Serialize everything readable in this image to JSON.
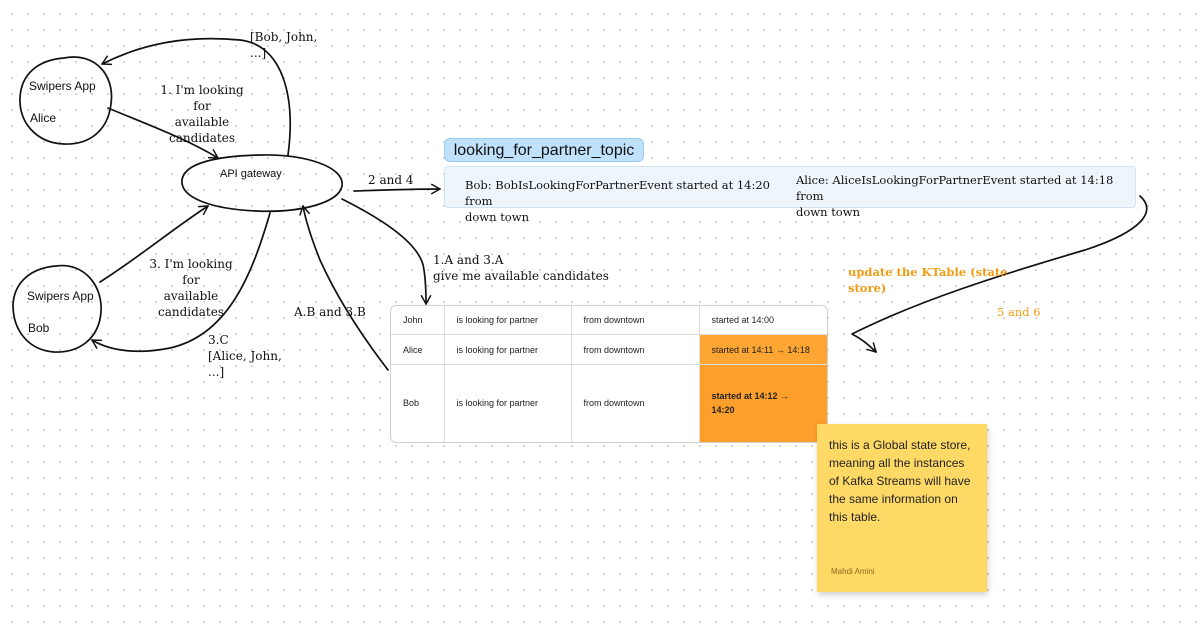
{
  "nodes": {
    "alice_app": {
      "title": "Swipers App",
      "user": "Alice"
    },
    "bob_app": {
      "title": "Swipers App",
      "user": "Bob"
    },
    "gateway": {
      "label": "API gateway"
    }
  },
  "annotations": {
    "alice_request": [
      "1. I'm looking for",
      "available",
      "candidates"
    ],
    "bob_request": [
      "3. I'm looking for",
      "available",
      "candidates"
    ],
    "alice_response": [
      "[Bob, John,",
      "...]"
    ],
    "bob_response": [
      "3.C",
      "[Alice, John,",
      "...]"
    ],
    "publish": "2 and 4",
    "query": [
      "1.A and 3.A",
      "give me available candidates"
    ],
    "query_result": "A.B and 3.B",
    "update_label": [
      "update the KTable (state",
      "store)"
    ],
    "update_steps": "5 and 6"
  },
  "topic": {
    "name": "looking_for_partner_topic",
    "events": [
      [
        "Bob: BobIsLookingForPartnerEvent started at 14:20 from",
        "down town"
      ],
      [
        "Alice: AliceIsLookingForPartnerEvent started at 14:18 from",
        "down town"
      ]
    ]
  },
  "ktable": {
    "rows": [
      {
        "name": "John",
        "status": "is looking for partner",
        "location": "from downtown",
        "started": "started at 14:00"
      },
      {
        "name": "Alice",
        "status": "is looking for partner",
        "location": "from downtown",
        "started": "started at 14:11 → 14:18"
      },
      {
        "name": "Bob",
        "status": "is looking for partner",
        "location": "from downtown",
        "started": "started at 14:12 →",
        "started2": "14:20"
      }
    ]
  },
  "sticky_note": {
    "lines": [
      "this is a Global state store,",
      "meaning all the instances",
      "of Kafka Streams will have",
      "the same information on",
      "this table."
    ],
    "author": "Mahdi Amini"
  },
  "colors": {
    "topic_pill": "#bfe1fb",
    "topic_box": "#eef6fc",
    "highlight": "#fea633",
    "sticky": "#ffd966",
    "orange_text": "#f39c12"
  }
}
